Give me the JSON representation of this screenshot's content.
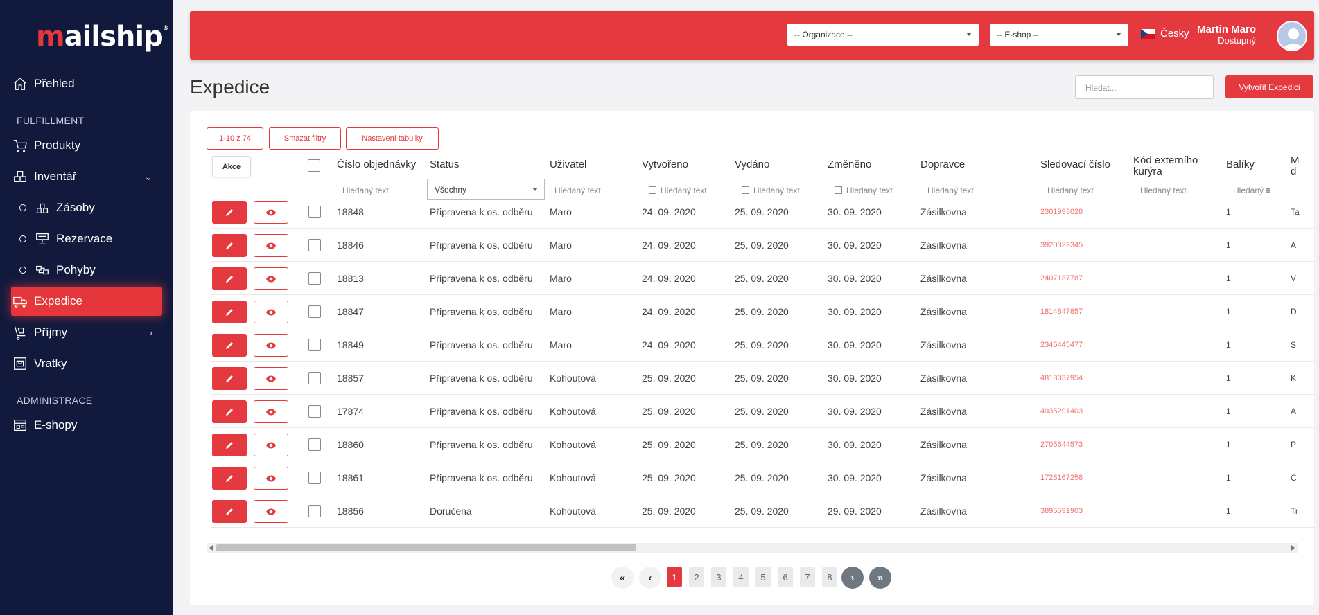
{
  "sidebar": {
    "logo": {
      "m": "m",
      "rest": "ailship",
      "reg": "®"
    },
    "items": [
      {
        "label": "Přehled",
        "icon": "home-icon"
      },
      {
        "label": "Produkty",
        "icon": "cart-icon"
      },
      {
        "label": "Inventář",
        "icon": "boxes-icon"
      },
      {
        "label": "Zásoby",
        "icon": "stock-icon"
      },
      {
        "label": "Rezervace",
        "icon": "reservation-icon"
      },
      {
        "label": "Pohyby",
        "icon": "movements-icon"
      },
      {
        "label": "Expedice",
        "icon": "truck-icon"
      },
      {
        "label": "Příjmy",
        "icon": "dolly-icon"
      },
      {
        "label": "Vratky",
        "icon": "return-icon"
      },
      {
        "label": "E-shopy",
        "icon": "store-icon"
      }
    ],
    "sections": {
      "fulfillment": "FULFILLMENT",
      "administrace": "ADMINISTRACE"
    }
  },
  "topbar": {
    "organizace": "-- Organizace --",
    "eshop": "-- E-shop --",
    "language": "Česky",
    "user_name": "Martin Maro",
    "user_status": "Dostupný"
  },
  "page": {
    "title": "Expedice",
    "search_placeholder": "Hledat...",
    "create_label": "Vytvořit Expedici"
  },
  "toolbar": {
    "range": "1-10 z 74",
    "clear_filters": "Smazat filtry",
    "table_settings": "Nastavení tabulky",
    "akce": "Akce"
  },
  "table": {
    "headers": [
      "Číslo objednávky",
      "Status",
      "Uživatel",
      "Vytvořeno",
      "Vydáno",
      "Změněno",
      "Dopravce",
      "Sledovací číslo",
      "Kód externího kurýra",
      "Balíky",
      "M d"
    ],
    "filter_placeholder": "Hledaný text",
    "filter_short": "Hledaný",
    "status_filter": "Všechny",
    "rows": [
      {
        "order": "18848",
        "status": "Připravena k os. odběru",
        "user": "Maro",
        "created": "24. 09. 2020",
        "issued": "25. 09. 2020",
        "changed": "30. 09. 2020",
        "carrier": "Zásilkovna",
        "tracking": "2301993028",
        "packages": "1",
        "extra": "Ta"
      },
      {
        "order": "18846",
        "status": "Připravena k os. odběru",
        "user": "Maro",
        "created": "24. 09. 2020",
        "issued": "25. 09. 2020",
        "changed": "30. 09. 2020",
        "carrier": "Zásilkovna",
        "tracking": "3920322345",
        "packages": "1",
        "extra": "A"
      },
      {
        "order": "18813",
        "status": "Připravena k os. odběru",
        "user": "Maro",
        "created": "24. 09. 2020",
        "issued": "25. 09. 2020",
        "changed": "30. 09. 2020",
        "carrier": "Zásilkovna",
        "tracking": "2407137787",
        "packages": "1",
        "extra": "V"
      },
      {
        "order": "18847",
        "status": "Připravena k os. odběru",
        "user": "Maro",
        "created": "24. 09. 2020",
        "issued": "25. 09. 2020",
        "changed": "30. 09. 2020",
        "carrier": "Zásilkovna",
        "tracking": "1814847857",
        "packages": "1",
        "extra": "D"
      },
      {
        "order": "18849",
        "status": "Připravena k os. odběru",
        "user": "Maro",
        "created": "24. 09. 2020",
        "issued": "25. 09. 2020",
        "changed": "30. 09. 2020",
        "carrier": "Zásilkovna",
        "tracking": "2346445477",
        "packages": "1",
        "extra": "S"
      },
      {
        "order": "18857",
        "status": "Připravena k os. odběru",
        "user": "Kohoutová",
        "created": "25. 09. 2020",
        "issued": "25. 09. 2020",
        "changed": "30. 09. 2020",
        "carrier": "Zásilkovna",
        "tracking": "4813037954",
        "packages": "1",
        "extra": "K"
      },
      {
        "order": "17874",
        "status": "Připravena k os. odběru",
        "user": "Kohoutová",
        "created": "25. 09. 2020",
        "issued": "25. 09. 2020",
        "changed": "30. 09. 2020",
        "carrier": "Zásilkovna",
        "tracking": "4935291403",
        "packages": "1",
        "extra": "A"
      },
      {
        "order": "18860",
        "status": "Připravena k os. odběru",
        "user": "Kohoutová",
        "created": "25. 09. 2020",
        "issued": "25. 09. 2020",
        "changed": "30. 09. 2020",
        "carrier": "Zásilkovna",
        "tracking": "2705644573",
        "packages": "1",
        "extra": "P"
      },
      {
        "order": "18861",
        "status": "Připravena k os. odběru",
        "user": "Kohoutová",
        "created": "25. 09. 2020",
        "issued": "25. 09. 2020",
        "changed": "30. 09. 2020",
        "carrier": "Zásilkovna",
        "tracking": "1728167258",
        "packages": "1",
        "extra": "C"
      },
      {
        "order": "18856",
        "status": "Doručena",
        "user": "Kohoutová",
        "created": "25. 09. 2020",
        "issued": "25. 09. 2020",
        "changed": "29. 09. 2020",
        "carrier": "Zásilkovna",
        "tracking": "3895591903",
        "packages": "1",
        "extra": "Tr"
      }
    ]
  },
  "pagination": {
    "first": "«",
    "prev": "‹",
    "pages": [
      "1",
      "2",
      "3",
      "4",
      "5",
      "6",
      "7",
      "8"
    ],
    "current": "1",
    "next": "›",
    "last": "»"
  },
  "colors": {
    "accent": "#e4393e",
    "sidebar": "#111a3d"
  }
}
